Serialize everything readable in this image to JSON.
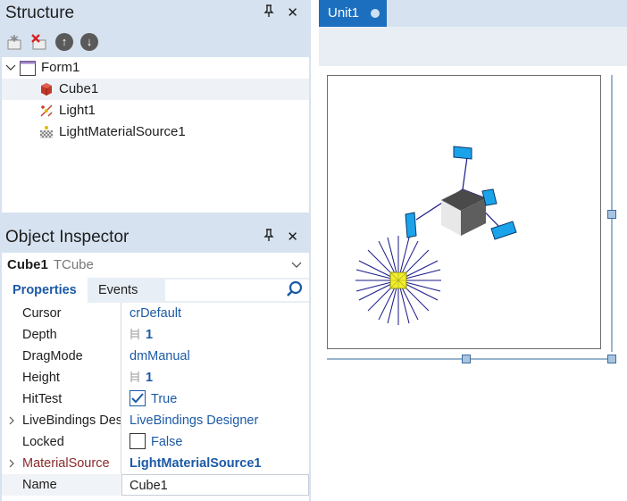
{
  "structure": {
    "title": "Structure",
    "pin_glyph": "⍑",
    "close_glyph": "✕",
    "toolbar": [
      "new-item-icon",
      "delete-item-icon",
      "move-up-icon",
      "move-down-icon"
    ],
    "tree": [
      {
        "label": "Form1",
        "icon": "form-icon",
        "expanded": true
      },
      {
        "label": "Cube1",
        "icon": "cube-icon",
        "selected": true
      },
      {
        "label": "Light1",
        "icon": "light-icon"
      },
      {
        "label": "LightMaterialSource1",
        "icon": "material-icon"
      }
    ]
  },
  "inspector": {
    "title": "Object Inspector",
    "component": {
      "name": "Cube1",
      "type": "TCube"
    },
    "tabs": [
      "Properties",
      "Events"
    ],
    "properties": [
      {
        "name": "Cursor",
        "value": "crDefault"
      },
      {
        "name": "Depth",
        "value": "1"
      },
      {
        "name": "DragMode",
        "value": "dmManual"
      },
      {
        "name": "Height",
        "value": "1"
      },
      {
        "name": "HitTest",
        "value": "True"
      },
      {
        "name": "LiveBindings Designer",
        "value": "LiveBindings Designer"
      },
      {
        "name": "Locked",
        "value": "False"
      },
      {
        "name": "MaterialSource",
        "value": "LightMaterialSource1"
      },
      {
        "name": "Name",
        "value": "Cube1"
      }
    ]
  },
  "editor": {
    "tab_label": "Unit1"
  },
  "colors": {
    "accent": "#1c6fbf",
    "panel_bg": "#d6e2f0",
    "value_blue": "#1c5aa6",
    "light_yellow": "#f2ef2a",
    "handle_blue": "#1aa3ea"
  }
}
